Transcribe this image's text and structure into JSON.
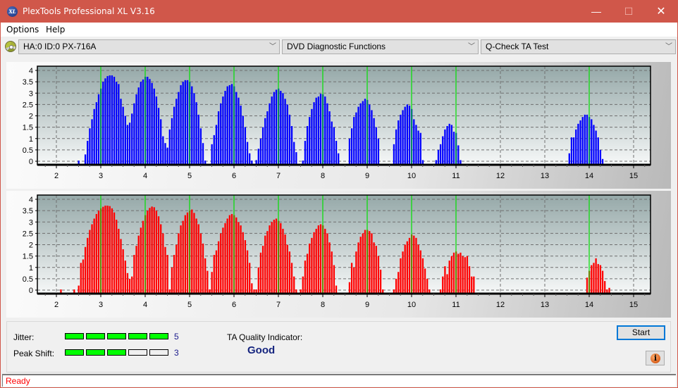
{
  "window": {
    "title": "PlexTools Professional XL V3.16",
    "app_icon_text": "XL",
    "controls": {
      "minimize": "—",
      "maximize": "☐",
      "close": "✕"
    }
  },
  "menu": {
    "items": [
      {
        "label": "Options"
      },
      {
        "label": "Help"
      }
    ]
  },
  "toolbar": {
    "drive_select": "HA:0 ID:0  PX-716A",
    "function_select": "DVD Diagnostic Functions",
    "test_select": "Q-Check TA Test",
    "chevron": "﹀"
  },
  "bottom": {
    "jitter_label": "Jitter:",
    "jitter_value": "5",
    "jitter_level": 5,
    "peak_shift_label": "Peak Shift:",
    "peak_shift_value": "3",
    "peak_shift_level": 3,
    "meter_max": 5,
    "ta_quality_label": "TA Quality Indicator:",
    "ta_quality_value": "Good",
    "start_label": "Start",
    "info_icon": "i"
  },
  "status": {
    "text": "Ready"
  },
  "colors": {
    "titlebar": "#d0574a",
    "blue_series": "#0000ff",
    "red_series": "#ff0000",
    "marker_lines": "#00e000",
    "meter_on": "#00ff00"
  },
  "chart_data": [
    {
      "type": "bar",
      "name": "top-chart",
      "series_color": "#0000ff",
      "xlim": [
        1.6,
        15.4
      ],
      "ylim": [
        0,
        4
      ],
      "xticks": [
        2,
        3,
        4,
        5,
        6,
        7,
        8,
        9,
        10,
        11,
        12,
        13,
        14,
        15
      ],
      "yticks": [
        0,
        0.5,
        1,
        1.5,
        2,
        2.5,
        3,
        3.5,
        4
      ],
      "ytick_labels": [
        "0",
        "0.5",
        "1",
        "1.5",
        "2",
        "2.5",
        "3",
        "3.5",
        "4"
      ],
      "grid": true,
      "marker_lines_x": [
        3,
        4,
        5,
        6,
        7,
        8,
        9,
        10,
        11,
        14
      ],
      "step": 0.05,
      "groups": [
        {
          "start": 2.5,
          "values": [
            0.03
          ]
        },
        {
          "start": 2.65,
          "values": [
            0.3,
            0.9,
            1.45,
            1.85,
            2.3,
            2.6,
            2.95,
            3.2,
            3.5,
            3.65,
            3.75,
            3.78,
            3.78,
            3.72,
            3.5,
            3.4,
            2.75,
            2.4,
            2.0,
            1.6
          ]
        },
        {
          "start": 3.65,
          "values": [
            1.7,
            2.1,
            2.55,
            2.95,
            3.25,
            3.5,
            3.6,
            3.72,
            3.72,
            3.62,
            3.45,
            3.2,
            2.85,
            2.35,
            1.85,
            1.1,
            0.8
          ]
        },
        {
          "start": 4.5,
          "values": [
            0.6,
            1.4,
            1.9,
            2.4,
            2.75,
            3.05,
            3.35,
            3.5,
            3.57,
            3.57,
            3.5,
            3.3,
            3.0,
            2.6,
            2.05,
            1.45,
            0.8,
            0.03
          ]
        },
        {
          "start": 5.5,
          "values": [
            0.75,
            1.15,
            1.6,
            2.2,
            2.55,
            2.85,
            3.1,
            3.3,
            3.35,
            3.4,
            3.3,
            3.05,
            2.8,
            2.45,
            2.0,
            1.5,
            0.85,
            0.35,
            0.03
          ]
        },
        {
          "start": 6.5,
          "values": [
            0.05,
            0.55,
            1.0,
            1.5,
            1.9,
            2.2,
            2.55,
            2.85,
            3.05,
            3.15,
            3.2,
            3.1,
            3.0,
            2.75,
            2.5,
            2.05,
            1.55,
            0.85,
            0.4
          ]
        },
        {
          "start": 7.55,
          "values": [
            0.03,
            0.9,
            1.55,
            1.95,
            2.3,
            2.6,
            2.8,
            2.85,
            2.97,
            2.95,
            2.85,
            2.55,
            2.2,
            1.75,
            1.5,
            0.9,
            0.35
          ]
        },
        {
          "start": 8.6,
          "values": [
            1.0,
            1.45,
            1.95,
            2.15,
            2.4,
            2.55,
            2.65,
            2.75,
            2.7,
            2.5,
            2.25,
            1.9,
            1.5,
            1.0
          ]
        },
        {
          "start": 9.6,
          "values": [
            0.75,
            1.4,
            1.8,
            2.05,
            2.25,
            2.4,
            2.5,
            2.45,
            2.3,
            1.85,
            1.6,
            1.35,
            1.25,
            0.05
          ]
        },
        {
          "start": 10.55,
          "values": [
            0.05,
            0.5,
            0.75,
            1.1,
            1.4,
            1.55,
            1.65,
            1.6,
            1.3,
            1.25,
            0.7,
            0.05
          ]
        },
        {
          "start": 13.55,
          "values": [
            0.35,
            1.05,
            1.05,
            1.4,
            1.65,
            1.8,
            1.95,
            2.05,
            2.05,
            1.95,
            1.85,
            1.6,
            1.35,
            1.05,
            0.5,
            0.1
          ]
        }
      ]
    },
    {
      "type": "bar",
      "name": "bottom-chart",
      "series_color": "#ff0000",
      "xlim": [
        1.6,
        15.4
      ],
      "ylim": [
        0,
        4
      ],
      "xticks": [
        2,
        3,
        4,
        5,
        6,
        7,
        8,
        9,
        10,
        11,
        12,
        13,
        14,
        15
      ],
      "yticks": [
        0,
        0.5,
        1,
        1.5,
        2,
        2.5,
        3,
        3.5,
        4
      ],
      "ytick_labels": [
        "0",
        "0.5",
        "1",
        "1.5",
        "2",
        "2.5",
        "3",
        "3.5",
        "4"
      ],
      "grid": true,
      "marker_lines_x": [
        3,
        4,
        5,
        6,
        7,
        8,
        9,
        10,
        11,
        14
      ],
      "step": 0.05,
      "groups": [
        {
          "start": 2.1,
          "values": [
            0.03
          ]
        },
        {
          "start": 2.4,
          "values": [
            0.03
          ]
        },
        {
          "start": 2.5,
          "values": [
            0.2,
            1.2,
            1.35,
            1.9,
            2.3,
            2.65,
            2.9,
            3.15,
            3.35,
            3.5,
            3.6,
            3.67,
            3.72,
            3.72,
            3.7,
            3.6,
            3.42,
            3.1,
            2.7,
            2.25,
            1.8,
            1.3,
            0.75,
            0.5,
            0.6
          ]
        },
        {
          "start": 3.75,
          "values": [
            1.55,
            1.95,
            2.4,
            2.75,
            3.05,
            3.3,
            3.5,
            3.62,
            3.68,
            3.65,
            3.5,
            3.25,
            2.9,
            2.5,
            1.9,
            1.55,
            0.03,
            0.5
          ]
        },
        {
          "start": 4.6,
          "values": [
            1.0,
            1.55,
            2.0,
            2.5,
            2.85,
            3.05,
            3.3,
            3.42,
            3.5,
            3.55,
            3.4,
            3.15,
            2.9,
            2.5,
            2.05,
            1.4,
            0.85,
            0.03
          ]
        },
        {
          "start": 5.45,
          "values": [
            0.03,
            0.8,
            1.55,
            1.75,
            2.15,
            2.5,
            2.75,
            2.95,
            3.15,
            3.3,
            3.35,
            3.3,
            3.2,
            3.0,
            2.85,
            2.55,
            2.2,
            1.75,
            1.2,
            0.3,
            0.03
          ]
        },
        {
          "start": 6.5,
          "values": [
            0.03,
            1.0,
            1.65,
            1.95,
            2.4,
            2.6,
            2.85,
            3.0,
            3.1,
            3.15,
            3.05,
            2.95,
            2.7,
            2.45,
            2.0,
            1.7,
            1.2,
            0.6,
            0.03
          ]
        },
        {
          "start": 7.5,
          "values": [
            0.03,
            0.6,
            1.3,
            1.6,
            2.05,
            2.3,
            2.55,
            2.7,
            2.85,
            2.9,
            2.85,
            2.7,
            2.5,
            2.1,
            1.7,
            1.1,
            0.2
          ]
        },
        {
          "start": 8.6,
          "values": [
            0.35,
            1.2,
            1.0,
            1.7,
            2.1,
            2.35,
            2.5,
            2.65,
            2.65,
            2.6,
            2.5,
            2.1,
            1.95,
            1.5,
            0.9,
            0.03
          ]
        },
        {
          "start": 9.6,
          "values": [
            0.03,
            0.5,
            0.8,
            1.4,
            1.7,
            2.0,
            2.15,
            2.3,
            2.45,
            2.4,
            2.3,
            2.0,
            1.75,
            1.4,
            0.95,
            0.5,
            0.03
          ]
        },
        {
          "start": 10.65,
          "values": [
            0.03,
            0.6,
            1.05,
            0.7,
            1.3,
            1.5,
            1.65,
            1.7,
            1.6,
            1.65,
            1.5,
            1.45,
            1.5,
            1.05,
            0.6,
            0.6
          ]
        },
        {
          "start": 13.95,
          "values": [
            0.55,
            0.85,
            1.1,
            1.2,
            1.4,
            1.15,
            1.1,
            0.85,
            0.4,
            0.03,
            0.1
          ]
        }
      ]
    }
  ]
}
